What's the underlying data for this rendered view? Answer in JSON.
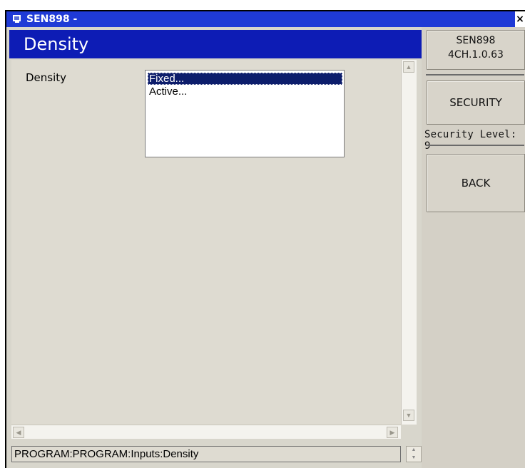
{
  "window": {
    "title": "SEN898 -",
    "close_glyph": "×"
  },
  "header": {
    "title": "Density"
  },
  "form": {
    "field_label": "Density",
    "options": [
      "Fixed...",
      "Active..."
    ],
    "selected": "Fixed..."
  },
  "status": {
    "path": "PROGRAM:PROGRAM:Inputs:Density"
  },
  "side": {
    "device_name": "SEN898",
    "firmware": "4CH.1.0.63",
    "security_label": "SECURITY",
    "security_level": "Security Level: 9",
    "back_label": "BACK"
  },
  "colors": {
    "titlebar": "#1f3ad6",
    "header": "#0d1cb5",
    "selection": "#0d1d6b",
    "panel": "#d8d6cc"
  }
}
